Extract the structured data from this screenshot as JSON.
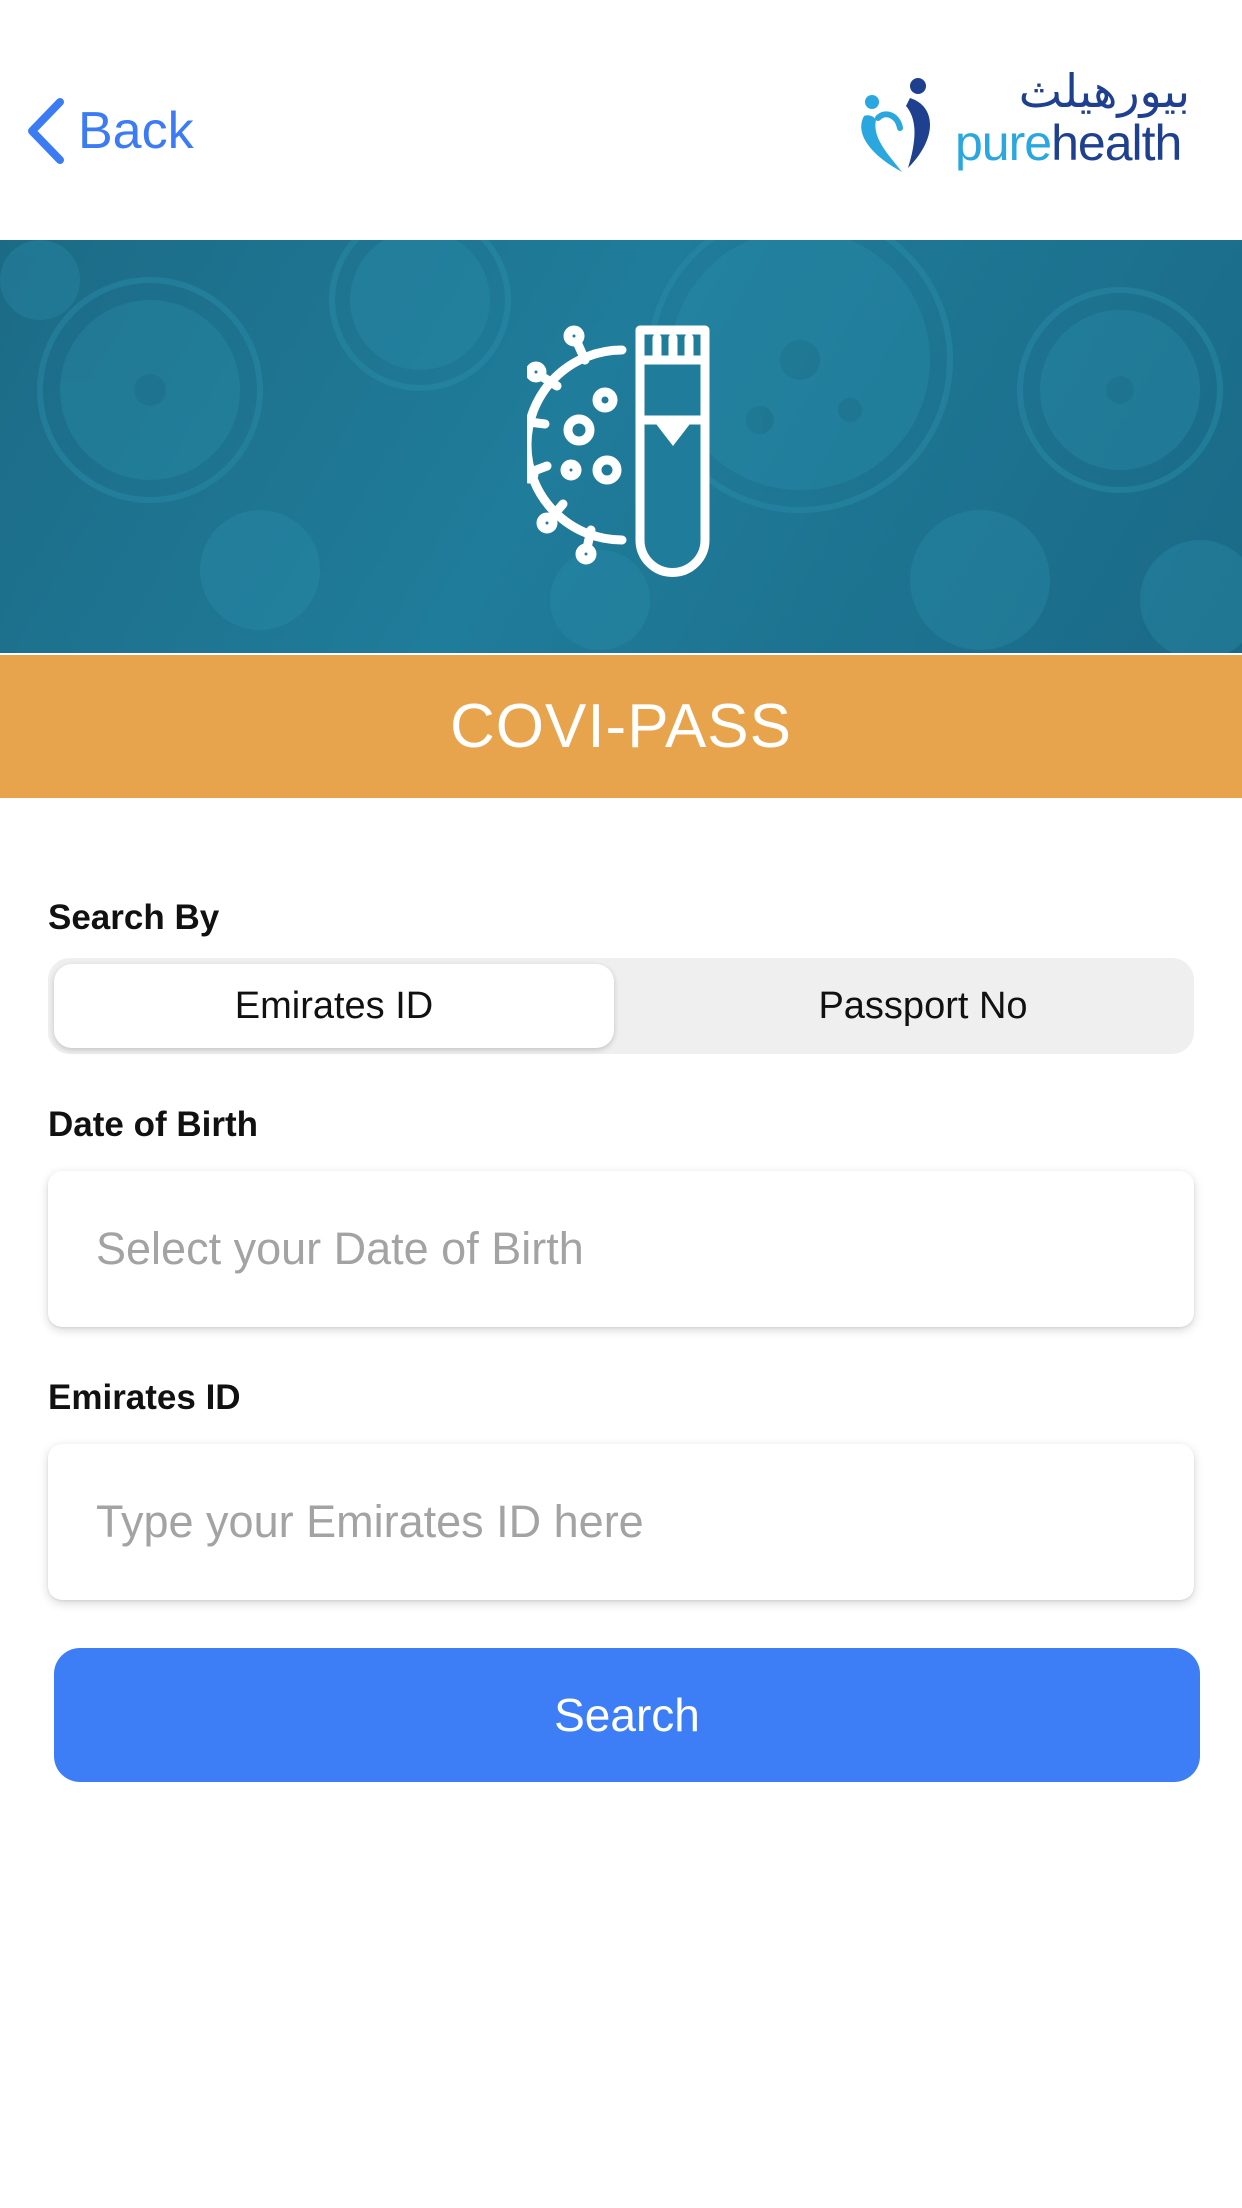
{
  "header": {
    "back_label": "Back",
    "logo_arabic": "بيورهيلث",
    "logo_pure": "pure",
    "logo_health": "health"
  },
  "banner": {
    "icon": "virus-test-tube-icon"
  },
  "title": "COVI-PASS",
  "form": {
    "search_by_label": "Search By",
    "segments": [
      {
        "label": "Emirates ID",
        "selected": true
      },
      {
        "label": "Passport No",
        "selected": false
      }
    ],
    "dob_label": "Date of Birth",
    "dob_placeholder": "Select your Date of Birth",
    "id_label": "Emirates ID",
    "id_placeholder": "Type your Emirates ID here",
    "search_button": "Search"
  },
  "colors": {
    "accent_blue": "#3d7ef6",
    "title_band": "#e8a44d",
    "banner": "#1f7c9a",
    "brand_dark": "#1f3f8f",
    "brand_light": "#2aa7df"
  }
}
